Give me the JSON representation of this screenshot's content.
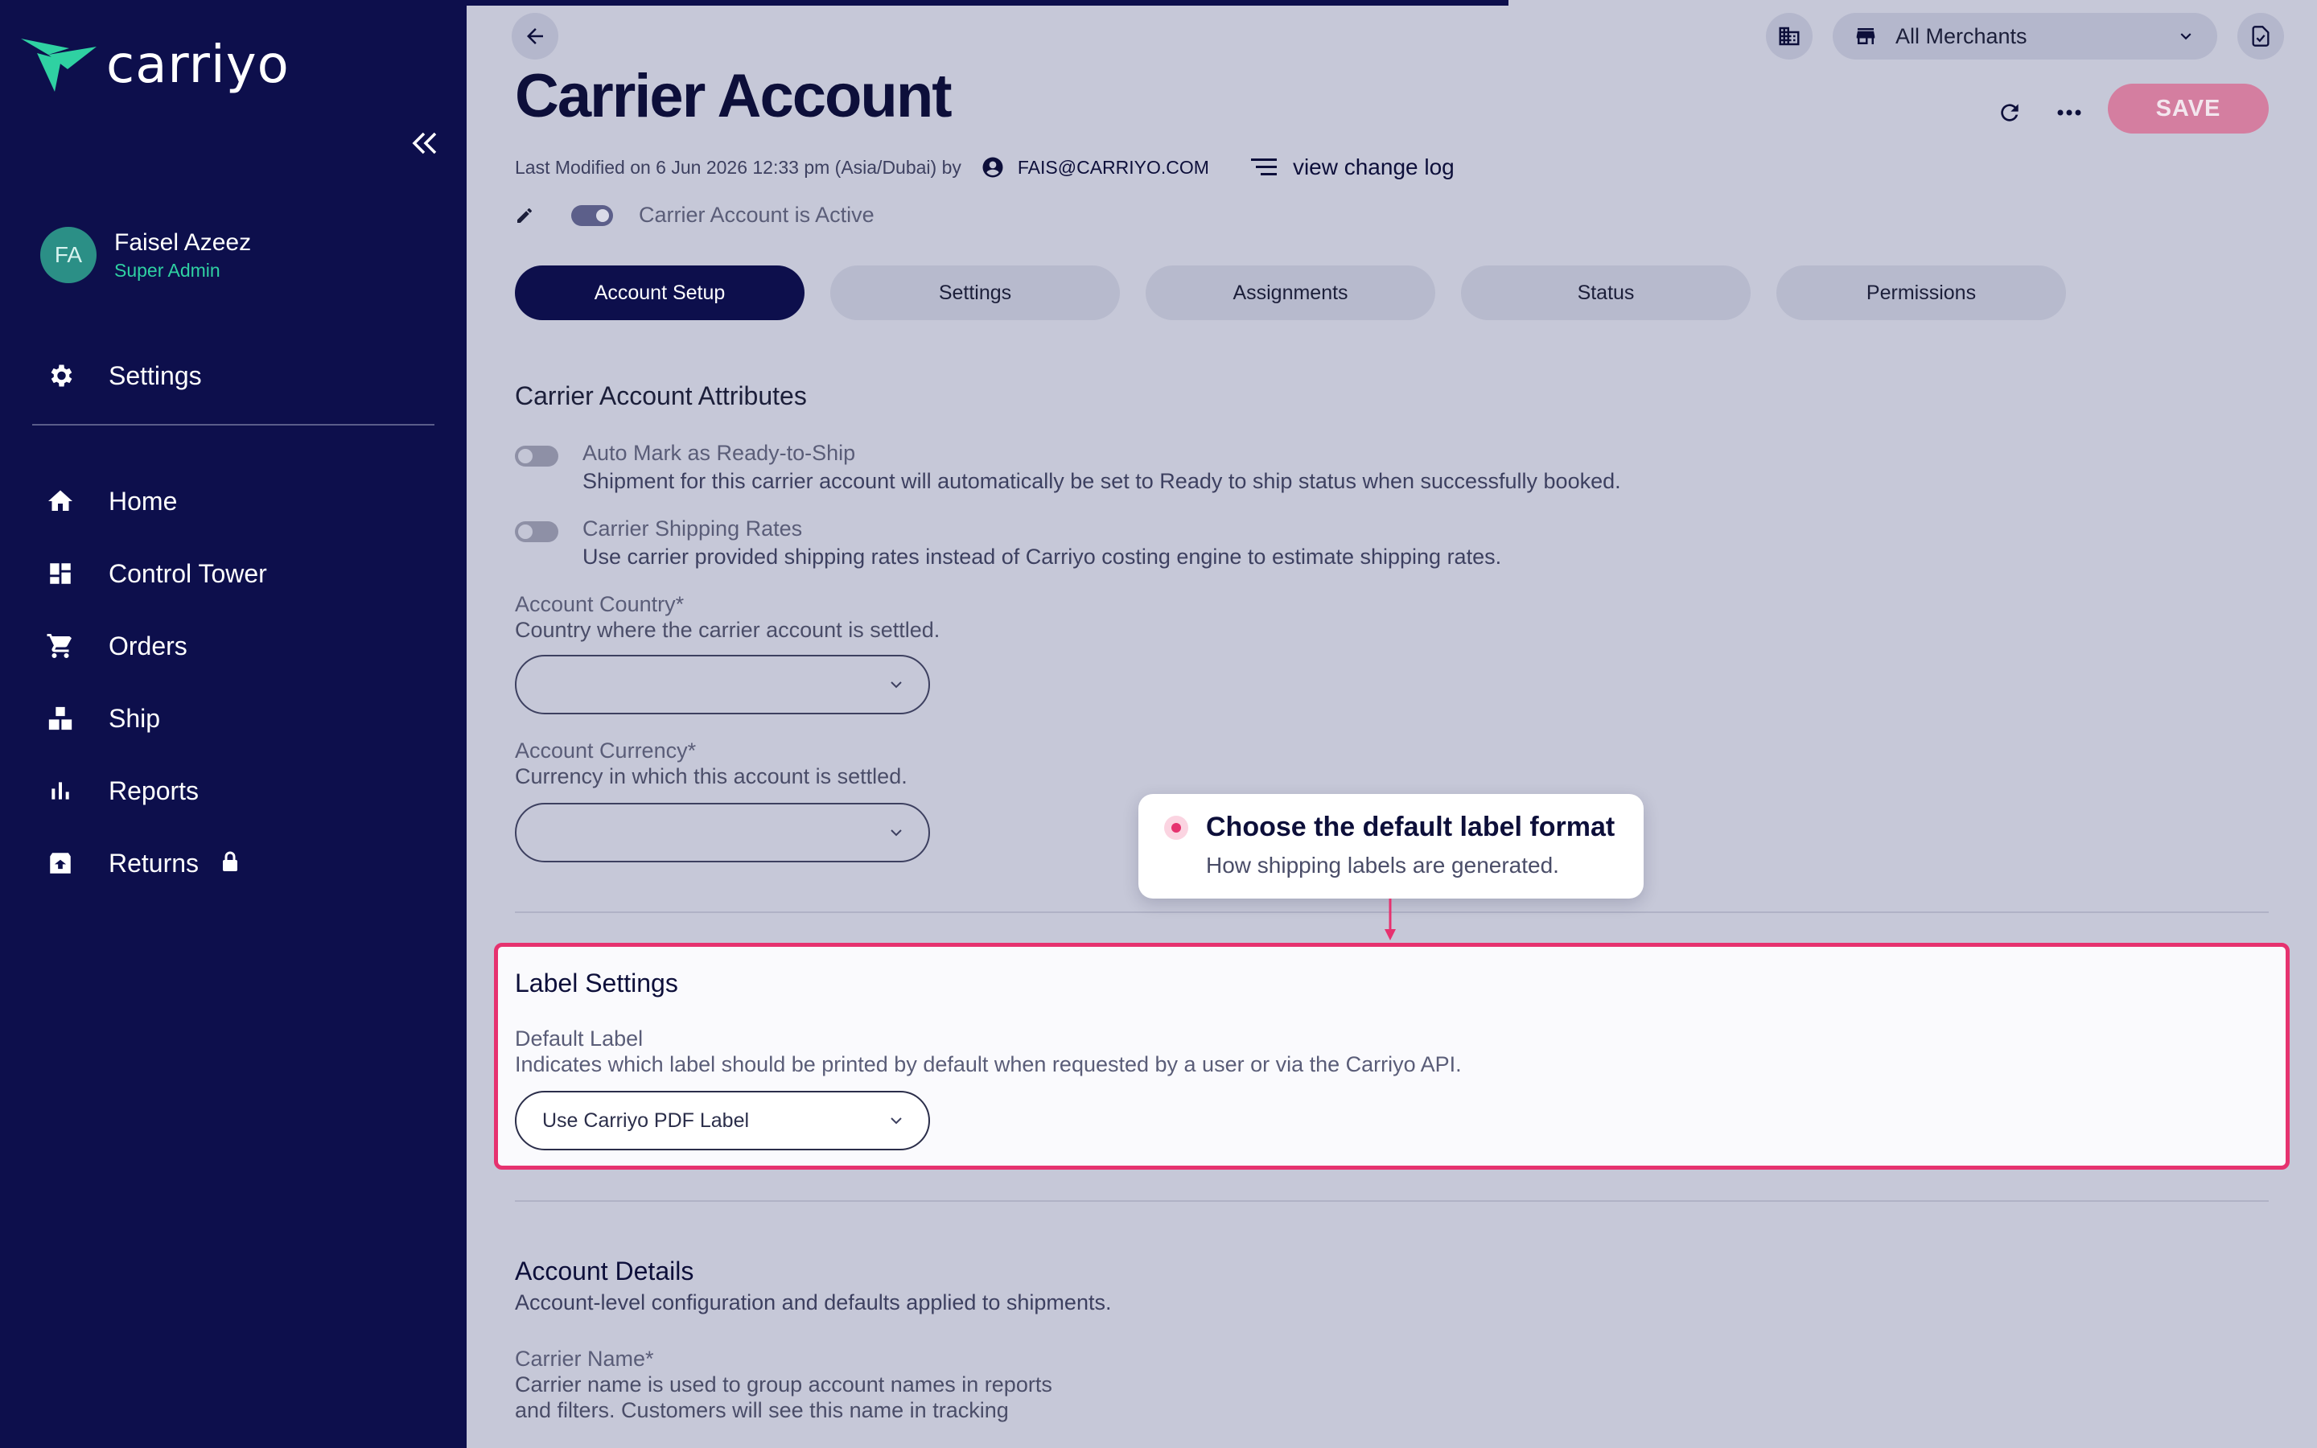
{
  "app": {
    "logo_text": "carriyo"
  },
  "user": {
    "initials": "FA",
    "name": "Faisel Azeez",
    "role": "Super Admin"
  },
  "sidebar": {
    "settings_label": "Settings",
    "items": [
      {
        "label": "Home",
        "icon": "home-icon"
      },
      {
        "label": "Control Tower",
        "icon": "dashboard-icon"
      },
      {
        "label": "Orders",
        "icon": "cart-icon"
      },
      {
        "label": "Ship",
        "icon": "boxes-icon"
      },
      {
        "label": "Reports",
        "icon": "bar-chart-icon"
      },
      {
        "label": "Returns",
        "icon": "return-box-icon",
        "locked": true
      }
    ]
  },
  "header": {
    "merchant_select": "All Merchants",
    "title": "Carrier Account",
    "save_label": "SAVE",
    "modified_text": "Last Modified on 6 Jun 2026 12:33 pm (Asia/Dubai) by",
    "modified_by": "FAIS@CARRIYO.COM",
    "changelog_label": "view change log",
    "active_label": "Carrier Account is Active"
  },
  "tabs": [
    {
      "label": "Account Setup",
      "active": true
    },
    {
      "label": "Settings",
      "active": false
    },
    {
      "label": "Assignments",
      "active": false
    },
    {
      "label": "Status",
      "active": false
    },
    {
      "label": "Permissions",
      "active": false
    }
  ],
  "attributes": {
    "title": "Carrier Account Attributes",
    "auto_mark": {
      "title": "Auto Mark as Ready-to-Ship",
      "desc": "Shipment for this carrier account will automatically be set to Ready to ship status when successfully booked.",
      "enabled": false
    },
    "shipping_rates": {
      "title": "Carrier Shipping Rates",
      "desc": "Use carrier provided shipping rates instead of Carriyo costing engine to estimate shipping rates.",
      "enabled": false
    },
    "country": {
      "label": "Account Country*",
      "desc": "Country where the carrier account is settled.",
      "value": ""
    },
    "currency": {
      "label": "Account Currency*",
      "desc": "Currency in which this account is settled.",
      "value": ""
    }
  },
  "label_settings": {
    "title": "Label Settings",
    "default_label": "Default Label",
    "desc": "Indicates which label should be printed by default when requested by a user or via the Carriyo API.",
    "value": "Use Carriyo PDF Label"
  },
  "tooltip": {
    "title": "Choose the default label format",
    "subtitle": "How shipping labels are generated."
  },
  "account_details": {
    "title": "Account Details",
    "desc": "Account-level configuration and defaults applied to shipments.",
    "carrier_name_label": "Carrier Name*",
    "carrier_name_desc_1": "Carrier name is used to group account names in reports",
    "carrier_name_desc_2": "and filters. Customers will see this name in tracking"
  },
  "colors": {
    "sidebar_bg": "#0d0f4c",
    "accent_pink": "#e6326f",
    "role_green": "#2fd1a2",
    "save_bg": "#d47ea0"
  }
}
